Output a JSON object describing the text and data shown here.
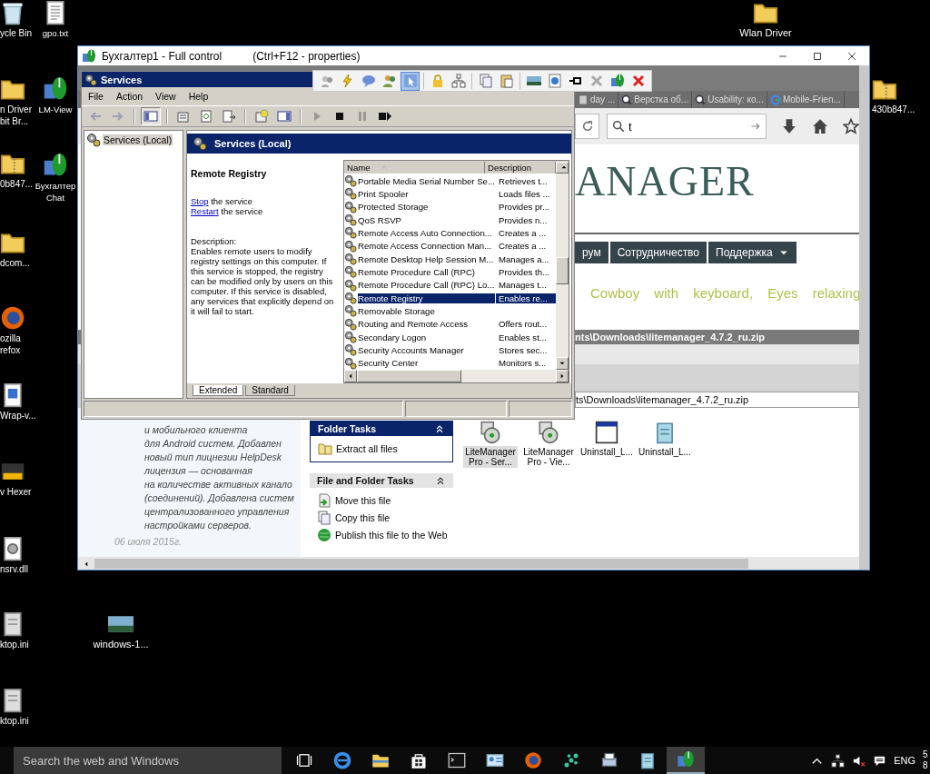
{
  "desktop_icons": [
    {
      "label": "ycle Bin",
      "kind": "bin"
    },
    {
      "label": "n Driver\nbit Br...",
      "kind": "folder"
    },
    {
      "label": "0b847...",
      "kind": "zip"
    },
    {
      "label": "dcom...",
      "kind": "folder"
    },
    {
      "label": "ozilla\nrefox",
      "kind": "firefox"
    },
    {
      "label": "Wrap-v...",
      "kind": "document"
    },
    {
      "label": "v Hexer",
      "kind": "hexer"
    },
    {
      "label": "nsrv.dll",
      "kind": "dll"
    },
    {
      "label": "ktop.ini",
      "kind": "ini"
    },
    {
      "label": "ktop.ini",
      "kind": "ini"
    },
    {
      "label": "gpo.txt",
      "kind": "text"
    },
    {
      "label": "LM-View",
      "kind": "lm"
    },
    {
      "label": "Бухгалтер\nChat",
      "kind": "lm"
    },
    {
      "label": "windows-1...",
      "kind": "image"
    },
    {
      "label": "Wlan Driver",
      "kind": "folder"
    },
    {
      "label": "430b847...",
      "kind": "zip"
    }
  ],
  "remote_window": {
    "title": "Бухгалтер1 - Full control",
    "hint": "(Ctrl+F12 - properties)"
  },
  "services": {
    "title": "Services",
    "menu": [
      "File",
      "Action",
      "View",
      "Help"
    ],
    "toolbar": [
      {
        "kind": "back",
        "disabled": true,
        "pressed": false
      },
      {
        "kind": "forward",
        "disabled": true,
        "pressed": false
      },
      {
        "kind": "separator"
      },
      {
        "kind": "tree",
        "disabled": false,
        "pressed": true
      },
      {
        "kind": "separator"
      },
      {
        "kind": "properties",
        "disabled": false,
        "pressed": false
      },
      {
        "kind": "refresh",
        "disabled": false,
        "pressed": false
      },
      {
        "kind": "export",
        "disabled": false,
        "pressed": false
      },
      {
        "kind": "separator"
      },
      {
        "kind": "help",
        "disabled": false,
        "pressed": false
      },
      {
        "kind": "view",
        "disabled": false,
        "pressed": false
      },
      {
        "kind": "separator"
      },
      {
        "kind": "play",
        "disabled": true,
        "pressed": false
      },
      {
        "kind": "stop",
        "disabled": false,
        "pressed": false
      },
      {
        "kind": "pause",
        "disabled": true,
        "pressed": false
      },
      {
        "kind": "restart",
        "disabled": false,
        "pressed": false
      }
    ],
    "tree": [
      {
        "label": "Services (Local)",
        "selected": true
      }
    ],
    "header": "Services (Local)",
    "detail": {
      "title": "Remote Registry",
      "links": [
        {
          "link": "Stop",
          "rest": " the service"
        },
        {
          "link": "Restart",
          "rest": " the service"
        }
      ],
      "description_label": "Description:",
      "description": "Enables remote users to modify registry settings on this computer. If this service is stopped, the registry can be modified only by users on this computer. If this service is disabled, any services that explicitly depend on it will fail to start."
    },
    "columns": [
      "Name",
      "Description"
    ],
    "rows": [
      {
        "name": "Portable Media Serial Number Se...",
        "description": "Retrieves t...",
        "selected": false
      },
      {
        "name": "Print Spooler",
        "description": "Loads files ...",
        "selected": false
      },
      {
        "name": "Protected Storage",
        "description": "Provides pr...",
        "selected": false
      },
      {
        "name": "QoS RSVP",
        "description": "Provides n...",
        "selected": false
      },
      {
        "name": "Remote Access Auto Connection...",
        "description": "Creates a ...",
        "selected": false
      },
      {
        "name": "Remote Access Connection Man...",
        "description": "Creates a ...",
        "selected": false
      },
      {
        "name": "Remote Desktop Help Session M...",
        "description": "Manages a...",
        "selected": false
      },
      {
        "name": "Remote Procedure Call (RPC)",
        "description": "Provides th...",
        "selected": false
      },
      {
        "name": "Remote Procedure Call (RPC) Lo...",
        "description": "Manages t...",
        "selected": false
      },
      {
        "name": "Remote Registry",
        "description": "Enables re...",
        "selected": true
      },
      {
        "name": "Removable Storage",
        "selected": false
      },
      {
        "name": "Routing and Remote Access",
        "description": "Offers rout...",
        "selected": false
      },
      {
        "name": "Secondary Logon",
        "description": "Enables st...",
        "selected": false
      },
      {
        "name": "Security Accounts Manager",
        "description": "Stores sec...",
        "selected": false
      },
      {
        "name": "Security Center",
        "description": "Monitors s...",
        "selected": false
      }
    ],
    "tabs": [
      {
        "label": "Extended",
        "selected": true
      },
      {
        "label": "Standard",
        "selected": false
      }
    ]
  },
  "floating_toolbar": [
    {
      "kind": "users-search",
      "selected": false
    },
    {
      "kind": "lightning",
      "selected": false
    },
    {
      "kind": "chat",
      "selected": false
    },
    {
      "kind": "users",
      "selected": false
    },
    {
      "kind": "pointer",
      "selected": true
    },
    {
      "kind": "lock",
      "selected": false
    },
    {
      "kind": "network",
      "selected": false
    },
    {
      "kind": "copy",
      "selected": false
    },
    {
      "kind": "paste",
      "selected": false
    },
    {
      "kind": "image",
      "selected": false
    },
    {
      "kind": "browser",
      "selected": false
    },
    {
      "kind": "pin",
      "selected": false
    },
    {
      "kind": "tools",
      "selected": false
    },
    {
      "kind": "lm",
      "selected": false
    },
    {
      "kind": "close",
      "selected": false
    }
  ],
  "browser": {
    "tabs": [
      {
        "label": "day ...",
        "kind": "plain",
        "selected": false
      },
      {
        "label": "Верстка об...",
        "kind": "magnifier",
        "selected": false
      },
      {
        "label": "Usability: ко...",
        "kind": "magnifier",
        "selected": false
      },
      {
        "label": "Mobile-Frien...",
        "kind": "circle",
        "selected": false
      }
    ],
    "search": {
      "value": "t"
    },
    "logo": "ANAGER",
    "menu": [
      {
        "label": "рум",
        "dropdown": false
      },
      {
        "label": "Сотрудничество",
        "dropdown": false
      },
      {
        "label": "Поддержка",
        "dropdown": true
      }
    ],
    "tagline": "Cowboy with keyboard, Eyes relaxing",
    "download_path": "nts\\Downloads\\litemanager_4.7.2_ru.zip"
  },
  "explorer": {
    "address": "ts\\Downloads\\litemanager_4.7.2_ru.zip",
    "article": "и мобильного клиента\nдля Android систем. Добавлен\nновый тип лицнезии HelpDesk\nлицензия — основанная\nна количестве активных канало\n(соединений). Добавлена систем\nцентрализованного управления\nнастройками серверов.",
    "article_date": "06 июля 2015г.",
    "panels": [
      {
        "title": "Folder Tasks",
        "kind": "primary",
        "items": [
          {
            "label": "Extract all files",
            "kind": "extract"
          }
        ]
      },
      {
        "title": "File and Folder Tasks",
        "kind": "secondary",
        "items": [
          {
            "label": "Move this file",
            "kind": "move"
          },
          {
            "label": "Copy this file",
            "kind": "copy"
          },
          {
            "label": "Publish this file to the Web",
            "kind": "publish"
          }
        ]
      }
    ],
    "files": [
      {
        "label": "LiteManager\nPro - Ser...",
        "kind": "installer",
        "selected": true
      },
      {
        "label": "LiteManager\nPro - Vie...",
        "kind": "installer",
        "selected": false
      },
      {
        "label": "Uninstall_L...",
        "kind": "window",
        "selected": false
      },
      {
        "label": "Uninstall_L...",
        "kind": "note",
        "selected": false
      }
    ]
  },
  "taskbar": {
    "search_placeholder": "Search the web and Windows",
    "apps": [
      {
        "kind": "taskview",
        "selected": false
      },
      {
        "kind": "edge",
        "selected": false
      },
      {
        "kind": "explorer",
        "selected": false
      },
      {
        "kind": "store",
        "selected": false
      },
      {
        "kind": "terminal",
        "selected": false
      },
      {
        "kind": "contact",
        "selected": false
      },
      {
        "kind": "firefox",
        "selected": false
      },
      {
        "kind": "dots",
        "selected": false
      },
      {
        "kind": "printer",
        "selected": false
      },
      {
        "kind": "note",
        "selected": false
      },
      {
        "kind": "lm",
        "selected": true
      }
    ],
    "tray": [
      {
        "kind": "chevron"
      },
      {
        "kind": "network"
      },
      {
        "kind": "volume"
      },
      {
        "kind": "notification"
      }
    ],
    "language": "ENG",
    "clock": [
      "5",
      "8"
    ]
  }
}
